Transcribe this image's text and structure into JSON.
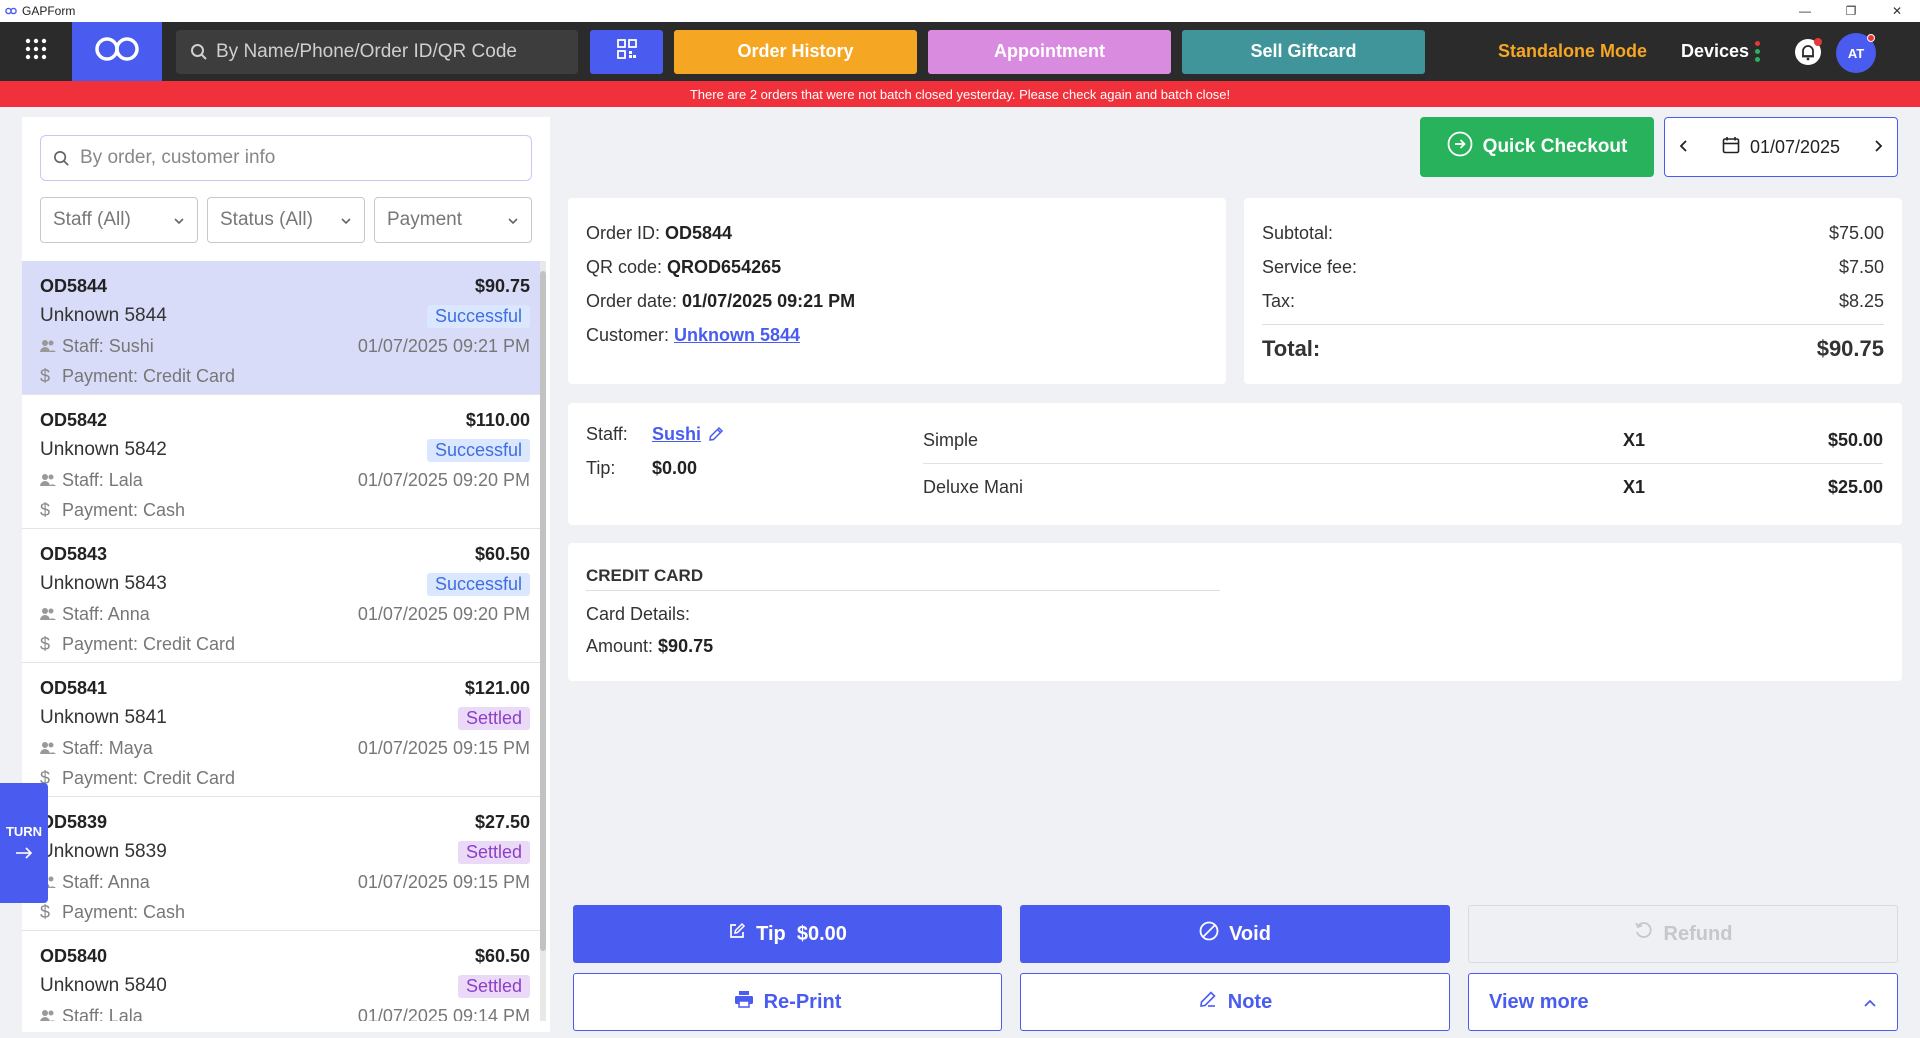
{
  "window": {
    "title": "GAPForm",
    "minimize": "—",
    "restore": "❐",
    "close": "✕"
  },
  "topbar": {
    "search_placeholder": "By Name/Phone/Order ID/QR Code",
    "order_history": "Order History",
    "appointment": "Appointment",
    "sell_giftcard": "Sell Giftcard",
    "mode": "Standalone Mode",
    "devices": "Devices",
    "avatar": "AT"
  },
  "alert": "There are 2 orders that were not batch closed yesterday. Please check again and batch close!",
  "left": {
    "search_placeholder": "By order, customer info",
    "filters": {
      "staff": "Staff (All)",
      "status": "Status (All)",
      "payment": "Payment"
    },
    "orders": [
      {
        "id": "OD5844",
        "amount": "$90.75",
        "customer": "Unknown 5844",
        "status": "Successful",
        "staff": "Staff: Sushi",
        "datetime": "01/07/2025 09:21 PM",
        "payment": "Payment: Credit Card"
      },
      {
        "id": "OD5842",
        "amount": "$110.00",
        "customer": "Unknown 5842",
        "status": "Successful",
        "staff": "Staff: Lala",
        "datetime": "01/07/2025 09:20 PM",
        "payment": "Payment: Cash"
      },
      {
        "id": "OD5843",
        "amount": "$60.50",
        "customer": "Unknown 5843",
        "status": "Successful",
        "staff": "Staff: Anna",
        "datetime": "01/07/2025 09:20 PM",
        "payment": "Payment: Credit Card"
      },
      {
        "id": "OD5841",
        "amount": "$121.00",
        "customer": "Unknown 5841",
        "status": "Settled",
        "staff": "Staff: Maya",
        "datetime": "01/07/2025 09:15 PM",
        "payment": "Payment: Credit Card"
      },
      {
        "id": "OD5839",
        "amount": "$27.50",
        "customer": "Unknown 5839",
        "status": "Settled",
        "staff": "Staff: Anna",
        "datetime": "01/07/2025 09:15 PM",
        "payment": "Payment: Cash"
      },
      {
        "id": "OD5840",
        "amount": "$60.50",
        "customer": "Unknown 5840",
        "status": "Settled",
        "staff": "Staff: Lala",
        "datetime": "01/07/2025 09:14 PM",
        "payment": ""
      }
    ]
  },
  "turn": {
    "label": "TURN"
  },
  "header": {
    "quick_checkout": "Quick Checkout",
    "date": "01/07/2025"
  },
  "order": {
    "id_label": "Order ID:",
    "id": "OD5844",
    "qr_label": "QR code:",
    "qr": "QROD654265",
    "date_label": "Order date:",
    "date": "01/07/2025 09:21 PM",
    "customer_label": "Customer:",
    "customer": "Unknown 5844"
  },
  "totals": {
    "subtotal_label": "Subtotal:",
    "subtotal": "$75.00",
    "fee_label": "Service fee:",
    "fee": "$7.50",
    "tax_label": "Tax:",
    "tax": "$8.25",
    "total_label": "Total:",
    "total": "$90.75"
  },
  "staff_card": {
    "staff_label": "Staff:",
    "staff": "Sushi",
    "tip_label": "Tip:",
    "tip": "$0.00",
    "items": [
      {
        "name": "Simple",
        "qty": "X1",
        "price": "$50.00"
      },
      {
        "name": "Deluxe Mani",
        "qty": "X1",
        "price": "$25.00"
      }
    ]
  },
  "payment_card": {
    "title": "CREDIT CARD",
    "details_label": "Card Details:",
    "amount_label": "Amount:",
    "amount": "$90.75"
  },
  "actions": {
    "tip": "Tip  $0.00",
    "void": "Void",
    "refund": "Refund",
    "reprint": "Re-Print",
    "note": "Note",
    "view_more": "View more"
  },
  "colors": {
    "accent": "#4a5cf0",
    "success": "#27b25b",
    "alert": "#f0303a",
    "orange": "#f5a623",
    "pink": "#d98be0",
    "teal": "#3f9599"
  }
}
